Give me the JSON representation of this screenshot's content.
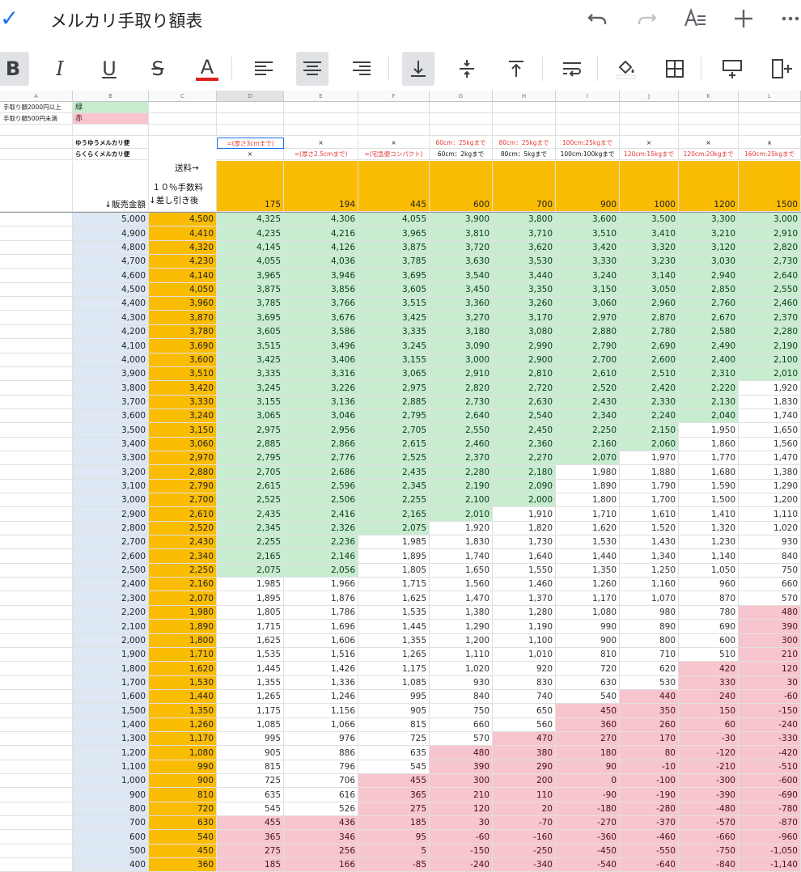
{
  "app": {
    "title": "メルカリ手取り額表"
  },
  "toolbar": {
    "bold": "B",
    "italic": "I",
    "underline": "U",
    "strike": "S",
    "textcolor": "A",
    "textcolor_bar": "#e02020"
  },
  "colors": {
    "green": "#c8ecd0",
    "pink": "#f7c5cd",
    "blue": "#dde8f4",
    "orange": "#fbbc04",
    "accent": "#1a73e8"
  },
  "sheet": {
    "column_letters": [
      "A",
      "B",
      "C",
      "D",
      "E",
      "F",
      "G",
      "H",
      "I",
      "J",
      "K",
      "L"
    ],
    "legend": [
      {
        "label": "手取り額2000円以上",
        "value": "緑"
      },
      {
        "label": "手取り額500円未満",
        "value": "赤"
      }
    ],
    "yuuyuu_label": "ゆうゆうメルカリ便",
    "rakuraku_label": "らくらくメルカリ便",
    "yuuyuu_values": [
      "=(厚さ3cmまで)",
      "×",
      "×",
      "60cm：25kgまで",
      "80cm：25kgまで",
      "100cm:25kgまで",
      "×",
      "×",
      "×"
    ],
    "rakuraku_values": [
      "×",
      "=(厚さ2.5cmまで)",
      "=(宅急便コンパクト)",
      "60cm：2kgまで",
      "80cm：5kgまで",
      "100cm:100kgまで",
      "120cm:15kgまで",
      "120cm:20kgまで",
      "160cm:25kgまで"
    ],
    "header_shipping": "送料→",
    "header_fee": "１０％手数料",
    "header_after": "↓差し引き後",
    "header_price": "↓販売金額",
    "shipping_costs": [
      "175",
      "194",
      "445",
      "600",
      "700",
      "900",
      "1000",
      "1200",
      "1500"
    ],
    "rows": [
      [
        "5,000",
        "4,500",
        "4,325",
        "4,306",
        "4,055",
        "3,900",
        "3,800",
        "3,600",
        "3,500",
        "3,300",
        "3,000"
      ],
      [
        "4,900",
        "4,410",
        "4,235",
        "4,216",
        "3,965",
        "3,810",
        "3,710",
        "3,510",
        "3,410",
        "3,210",
        "2,910"
      ],
      [
        "4,800",
        "4,320",
        "4,145",
        "4,126",
        "3,875",
        "3,720",
        "3,620",
        "3,420",
        "3,320",
        "3,120",
        "2,820"
      ],
      [
        "4,700",
        "4,230",
        "4,055",
        "4,036",
        "3,785",
        "3,630",
        "3,530",
        "3,330",
        "3,230",
        "3,030",
        "2,730"
      ],
      [
        "4,600",
        "4,140",
        "3,965",
        "3,946",
        "3,695",
        "3,540",
        "3,440",
        "3,240",
        "3,140",
        "2,940",
        "2,640"
      ],
      [
        "4,500",
        "4,050",
        "3,875",
        "3,856",
        "3,605",
        "3,450",
        "3,350",
        "3,150",
        "3,050",
        "2,850",
        "2,550"
      ],
      [
        "4,400",
        "3,960",
        "3,785",
        "3,766",
        "3,515",
        "3,360",
        "3,260",
        "3,060",
        "2,960",
        "2,760",
        "2,460"
      ],
      [
        "4,300",
        "3,870",
        "3,695",
        "3,676",
        "3,425",
        "3,270",
        "3,170",
        "2,970",
        "2,870",
        "2,670",
        "2,370"
      ],
      [
        "4,200",
        "3,780",
        "3,605",
        "3,586",
        "3,335",
        "3,180",
        "3,080",
        "2,880",
        "2,780",
        "2,580",
        "2,280"
      ],
      [
        "4,100",
        "3,690",
        "3,515",
        "3,496",
        "3,245",
        "3,090",
        "2,990",
        "2,790",
        "2,690",
        "2,490",
        "2,190"
      ],
      [
        "4,000",
        "3,600",
        "3,425",
        "3,406",
        "3,155",
        "3,000",
        "2,900",
        "2,700",
        "2,600",
        "2,400",
        "2,100"
      ],
      [
        "3,900",
        "3,510",
        "3,335",
        "3,316",
        "3,065",
        "2,910",
        "2,810",
        "2,610",
        "2,510",
        "2,310",
        "2,010"
      ],
      [
        "3,800",
        "3,420",
        "3,245",
        "3,226",
        "2,975",
        "2,820",
        "2,720",
        "2,520",
        "2,420",
        "2,220",
        "1,920"
      ],
      [
        "3,700",
        "3,330",
        "3,155",
        "3,136",
        "2,885",
        "2,730",
        "2,630",
        "2,430",
        "2,330",
        "2,130",
        "1,830"
      ],
      [
        "3,600",
        "3,240",
        "3,065",
        "3,046",
        "2,795",
        "2,640",
        "2,540",
        "2,340",
        "2,240",
        "2,040",
        "1,740"
      ],
      [
        "3,500",
        "3,150",
        "2,975",
        "2,956",
        "2,705",
        "2,550",
        "2,450",
        "2,250",
        "2,150",
        "1,950",
        "1,650"
      ],
      [
        "3,400",
        "3,060",
        "2,885",
        "2,866",
        "2,615",
        "2,460",
        "2,360",
        "2,160",
        "2,060",
        "1,860",
        "1,560"
      ],
      [
        "3,300",
        "2,970",
        "2,795",
        "2,776",
        "2,525",
        "2,370",
        "2,270",
        "2,070",
        "1,970",
        "1,770",
        "1,470"
      ],
      [
        "3,200",
        "2,880",
        "2,705",
        "2,686",
        "2,435",
        "2,280",
        "2,180",
        "1,980",
        "1,880",
        "1,680",
        "1,380"
      ],
      [
        "3,100",
        "2,790",
        "2,615",
        "2,596",
        "2,345",
        "2,190",
        "2,090",
        "1,890",
        "1,790",
        "1,590",
        "1,290"
      ],
      [
        "3,000",
        "2,700",
        "2,525",
        "2,506",
        "2,255",
        "2,100",
        "2,000",
        "1,800",
        "1,700",
        "1,500",
        "1,200"
      ],
      [
        "2,900",
        "2,610",
        "2,435",
        "2,416",
        "2,165",
        "2,010",
        "1,910",
        "1,710",
        "1,610",
        "1,410",
        "1,110"
      ],
      [
        "2,800",
        "2,520",
        "2,345",
        "2,326",
        "2,075",
        "1,920",
        "1,820",
        "1,620",
        "1,520",
        "1,320",
        "1,020"
      ],
      [
        "2,700",
        "2,430",
        "2,255",
        "2,236",
        "1,985",
        "1,830",
        "1,730",
        "1,530",
        "1,430",
        "1,230",
        "930"
      ],
      [
        "2,600",
        "2,340",
        "2,165",
        "2,146",
        "1,895",
        "1,740",
        "1,640",
        "1,440",
        "1,340",
        "1,140",
        "840"
      ],
      [
        "2,500",
        "2,250",
        "2,075",
        "2,056",
        "1,805",
        "1,650",
        "1,550",
        "1,350",
        "1,250",
        "1,050",
        "750"
      ],
      [
        "2,400",
        "2,160",
        "1,985",
        "1,966",
        "1,715",
        "1,560",
        "1,460",
        "1,260",
        "1,160",
        "960",
        "660"
      ],
      [
        "2,300",
        "2,070",
        "1,895",
        "1,876",
        "1,625",
        "1,470",
        "1,370",
        "1,170",
        "1,070",
        "870",
        "570"
      ],
      [
        "2,200",
        "1,980",
        "1,805",
        "1,786",
        "1,535",
        "1,380",
        "1,280",
        "1,080",
        "980",
        "780",
        "480"
      ],
      [
        "2,100",
        "1,890",
        "1,715",
        "1,696",
        "1,445",
        "1,290",
        "1,190",
        "990",
        "890",
        "690",
        "390"
      ],
      [
        "2,000",
        "1,800",
        "1,625",
        "1,606",
        "1,355",
        "1,200",
        "1,100",
        "900",
        "800",
        "600",
        "300"
      ],
      [
        "1,900",
        "1,710",
        "1,535",
        "1,516",
        "1,265",
        "1,110",
        "1,010",
        "810",
        "710",
        "510",
        "210"
      ],
      [
        "1,800",
        "1,620",
        "1,445",
        "1,426",
        "1,175",
        "1,020",
        "920",
        "720",
        "620",
        "420",
        "120"
      ],
      [
        "1,700",
        "1,530",
        "1,355",
        "1,336",
        "1,085",
        "930",
        "830",
        "630",
        "530",
        "330",
        "30"
      ],
      [
        "1,600",
        "1,440",
        "1,265",
        "1,246",
        "995",
        "840",
        "740",
        "540",
        "440",
        "240",
        "-60"
      ],
      [
        "1,500",
        "1,350",
        "1,175",
        "1,156",
        "905",
        "750",
        "650",
        "450",
        "350",
        "150",
        "-150"
      ],
      [
        "1,400",
        "1,260",
        "1,085",
        "1,066",
        "815",
        "660",
        "560",
        "360",
        "260",
        "60",
        "-240"
      ],
      [
        "1,300",
        "1,170",
        "995",
        "976",
        "725",
        "570",
        "470",
        "270",
        "170",
        "-30",
        "-330"
      ],
      [
        "1,200",
        "1,080",
        "905",
        "886",
        "635",
        "480",
        "380",
        "180",
        "80",
        "-120",
        "-420"
      ],
      [
        "1,100",
        "990",
        "815",
        "796",
        "545",
        "390",
        "290",
        "90",
        "-10",
        "-210",
        "-510"
      ],
      [
        "1,000",
        "900",
        "725",
        "706",
        "455",
        "300",
        "200",
        "0",
        "-100",
        "-300",
        "-600"
      ],
      [
        "900",
        "810",
        "635",
        "616",
        "365",
        "210",
        "110",
        "-90",
        "-190",
        "-390",
        "-690"
      ],
      [
        "800",
        "720",
        "545",
        "526",
        "275",
        "120",
        "20",
        "-180",
        "-280",
        "-480",
        "-780"
      ],
      [
        "700",
        "630",
        "455",
        "436",
        "185",
        "30",
        "-70",
        "-270",
        "-370",
        "-570",
        "-870"
      ],
      [
        "600",
        "540",
        "365",
        "346",
        "95",
        "-60",
        "-160",
        "-360",
        "-460",
        "-660",
        "-960"
      ],
      [
        "500",
        "450",
        "275",
        "256",
        "5",
        "-150",
        "-250",
        "-450",
        "-550",
        "-750",
        "-1,050"
      ],
      [
        "400",
        "360",
        "185",
        "166",
        "-85",
        "-240",
        "-340",
        "-540",
        "-640",
        "-840",
        "-1,140"
      ]
    ]
  }
}
